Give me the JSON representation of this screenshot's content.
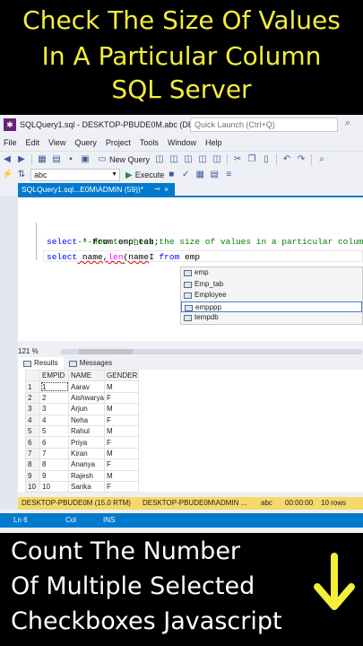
{
  "banner_top": {
    "line1": "Check The Size Of Values",
    "line2": "In A Particular Column",
    "line3": "SQL Server"
  },
  "titlebar": {
    "title": "SQLQuery1.sql - DESKTOP-PBUDE0M.abc (DE...",
    "quick_launch_placeholder": "Quick Launch (Ctrl+Q)"
  },
  "menu": [
    "File",
    "Edit",
    "View",
    "Query",
    "Project",
    "Tools",
    "Window",
    "Help"
  ],
  "toolbar": {
    "new_query": "New Query",
    "database": "abc",
    "execute": "Execute"
  },
  "tab": {
    "label": "SQLQuery1.sql...E0M\\ADMIN (59))*",
    "pin": "⊸",
    "close": "×"
  },
  "editor": {
    "comment": "---How to check the size of values in a particular column",
    "line2_kw": "select",
    "line2_rest": " * from emp_tab;",
    "line3_kw1": "select",
    "line3_a": " name,",
    "line3_fn": "len",
    "line3_b": "(name",
    "line3_caret": "I",
    "line3_kw2": " from",
    "line3_c": " emp"
  },
  "autocomplete": [
    "emp",
    "Emp_tab",
    "Employee",
    "empppp",
    "tempdb"
  ],
  "zoom": "121 %",
  "results_tabs": {
    "results": "Results",
    "messages": "Messages"
  },
  "grid": {
    "columns": [
      "EMPID",
      "NAME",
      "GENDER"
    ],
    "rows": [
      [
        "1",
        "1",
        "Aarav",
        "M"
      ],
      [
        "2",
        "2",
        "Aishwarya",
        "F"
      ],
      [
        "3",
        "3",
        "Arjun",
        "M"
      ],
      [
        "4",
        "4",
        "Neha",
        "F"
      ],
      [
        "5",
        "5",
        "Rahul",
        "M"
      ],
      [
        "6",
        "6",
        "Priya",
        "F"
      ],
      [
        "7",
        "7",
        "Kiran",
        "M"
      ],
      [
        "8",
        "8",
        "Ananya",
        "F"
      ],
      [
        "9",
        "9",
        "Rajesh",
        "M"
      ],
      [
        "10",
        "10",
        "Sarika",
        "F"
      ]
    ]
  },
  "status": {
    "server": "DESKTOP-PBUDE0M (15.0 RTM)",
    "user": "DESKTOP-PBUDE0M\\ADMIN ...",
    "db": "abc",
    "time": "00:00:00",
    "rows": "10 rows"
  },
  "bottom_status": {
    "ln": "Ln 6",
    "col": "Col",
    "ins": "INS"
  },
  "banner_bottom": {
    "line1": "Count The Number",
    "line2": "Of Multiple Selected",
    "line3": "Checkboxes  Javascript"
  },
  "colors": {
    "banner_top_text": "#f5ee3a",
    "arrow": "#f5ee3a",
    "accent": "#007acc",
    "status": "#f5d96b"
  }
}
